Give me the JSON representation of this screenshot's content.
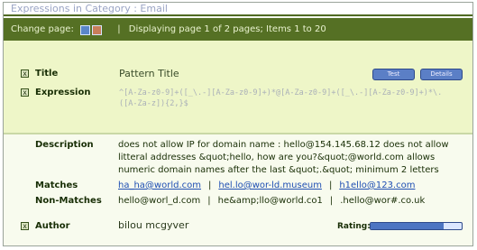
{
  "window": {
    "title": "Expressions in Category : Email"
  },
  "pager": {
    "label": "Change page:",
    "status": "Displaying page 1 of 2 pages; Items 1 to 20"
  },
  "pattern": {
    "title_label": "Title",
    "title_value": "Pattern Title",
    "test_button": "Test",
    "details_button": "Details",
    "expression_label": "Expression",
    "expression_value": "^[A-Za-z0-9]+([_\\.-][A-Za-z0-9]+)*@[A-Za-z0-9]+([_\\.-][A-Za-z0-9]+)*\\.([A-Za-z]){2,}$",
    "description_label": "Description",
    "description_value": "does not allow IP for domain name : hello@154.145.68.12 does not allow litteral addresses &quot;hello, how are you?&quot;@world.com allows numeric domain names after the last &quot;.&quot; minimum 2 letters",
    "matches_label": "Matches",
    "matches": [
      "ha_ha@world.com",
      "hel.lo@wor-ld.museum",
      "h1ello@123.com"
    ],
    "non_matches_label": "Non-Matches",
    "non_matches": [
      "hello@worl_d.com",
      "he&amp;llo@world.co1",
      ".hello@wor#.co.uk"
    ],
    "author_label": "Author",
    "author_value": "bilou mcgyver",
    "rating_label": "Rating:",
    "rating_fraction": 0.8
  },
  "colors": {
    "header_green": "#557024",
    "upper_bg": "#eef6c8",
    "link_blue": "#1f4fb3",
    "button_blue": "#5b7fc6"
  },
  "icons": {
    "pager_icons": [
      "page-first-icon",
      "page-next-icon"
    ],
    "row_toggle": "expand-icon"
  }
}
